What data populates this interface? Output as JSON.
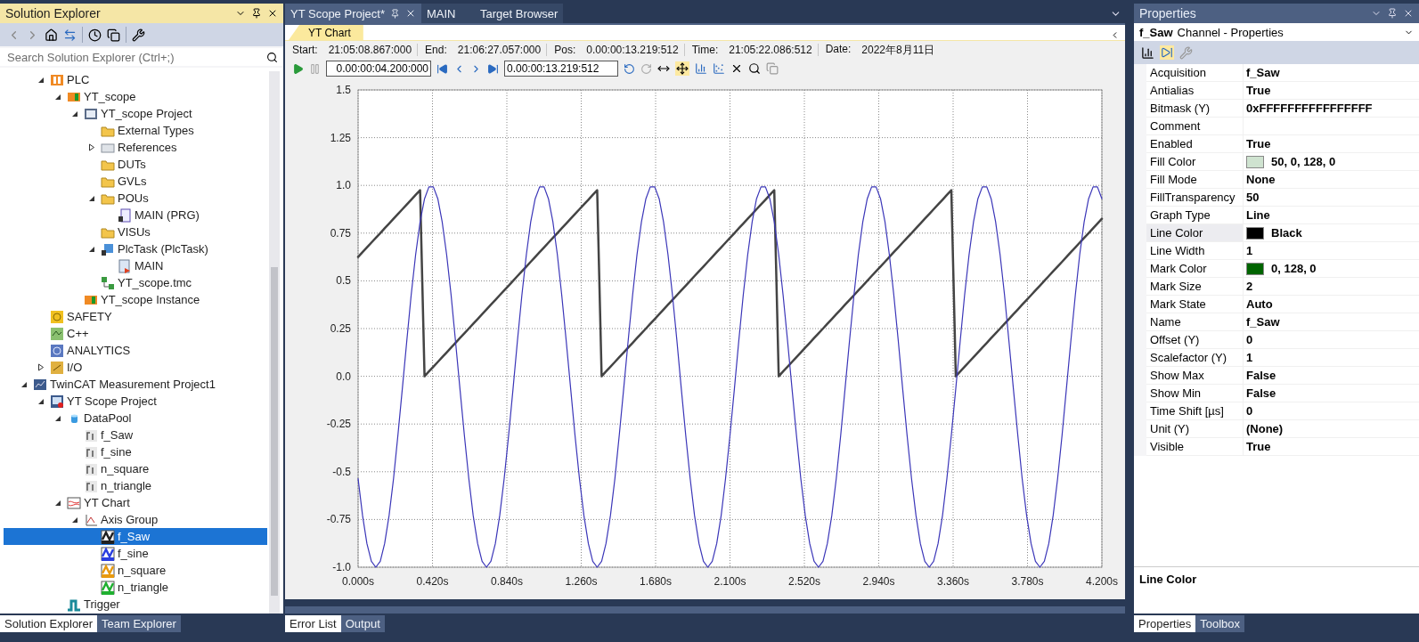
{
  "solution_explorer": {
    "title": "Solution Explorer",
    "search": {
      "placeholder": "Search Solution Explorer (Ctrl+;)"
    },
    "tree": [
      {
        "children": [
          {
            "label": "PLC",
            "kind": "plc",
            "expanded": true,
            "selected": false,
            "children": [
              {
                "label": "YT_scope",
                "kind": "plc-project",
                "expanded": true,
                "selected": false,
                "children": [
                  {
                    "label": "YT_scope Project",
                    "kind": "project",
                    "expanded": true,
                    "selected": false,
                    "children": [
                      {
                        "label": "External Types",
                        "kind": "folder",
                        "selected": false
                      },
                      {
                        "label": "References",
                        "kind": "references",
                        "expanded": false,
                        "selected": false
                      },
                      {
                        "label": "DUTs",
                        "kind": "folder",
                        "selected": false
                      },
                      {
                        "label": "GVLs",
                        "kind": "folder",
                        "selected": false
                      },
                      {
                        "label": "POUs",
                        "kind": "folder",
                        "expanded": true,
                        "selected": false,
                        "children": [
                          {
                            "label": "MAIN (PRG)",
                            "kind": "pou",
                            "selected": false
                          }
                        ]
                      },
                      {
                        "label": "VISUs",
                        "kind": "folder",
                        "selected": false
                      },
                      {
                        "label": "PlcTask (PlcTask)",
                        "kind": "task",
                        "expanded": true,
                        "selected": false,
                        "children": [
                          {
                            "label": "MAIN",
                            "kind": "task-call",
                            "selected": false
                          }
                        ]
                      },
                      {
                        "label": "YT_scope.tmc",
                        "kind": "tmc",
                        "selected": false
                      }
                    ]
                  },
                  {
                    "label": "YT_scope Instance",
                    "kind": "plc-project",
                    "selected": false
                  }
                ]
              }
            ]
          },
          {
            "label": "SAFETY",
            "kind": "safety",
            "selected": false
          },
          {
            "label": "C++",
            "kind": "cpp",
            "selected": false
          },
          {
            "label": "ANALYTICS",
            "kind": "analytics",
            "selected": false
          },
          {
            "label": "I/O",
            "kind": "io",
            "expanded": false,
            "selected": false
          }
        ]
      },
      {
        "label": "TwinCAT Measurement Project1",
        "kind": "measurement",
        "expanded": true,
        "selected": false,
        "children": [
          {
            "label": "YT Scope Project",
            "kind": "scope",
            "expanded": true,
            "selected": false,
            "children": [
              {
                "label": "DataPool",
                "kind": "datapool",
                "expanded": true,
                "selected": false,
                "children": [
                  {
                    "label": "f_Saw",
                    "kind": "var",
                    "selected": false
                  },
                  {
                    "label": "f_sine",
                    "kind": "var",
                    "selected": false
                  },
                  {
                    "label": "n_square",
                    "kind": "var",
                    "selected": false
                  },
                  {
                    "label": "n_triangle",
                    "kind": "var",
                    "selected": false
                  }
                ]
              },
              {
                "label": "YT Chart",
                "kind": "chart",
                "expanded": true,
                "selected": false,
                "children": [
                  {
                    "label": "Axis Group",
                    "kind": "axis",
                    "expanded": true,
                    "selected": false,
                    "children": [
                      {
                        "label": "f_Saw",
                        "kind": "channel",
                        "color": "#202020",
                        "selected": true
                      },
                      {
                        "label": "f_sine",
                        "kind": "channel",
                        "color": "#2a3ee0",
                        "selected": false
                      },
                      {
                        "label": "n_square",
                        "kind": "channel",
                        "color": "#e89a10",
                        "selected": false
                      },
                      {
                        "label": "n_triangle",
                        "kind": "channel",
                        "color": "#20b030",
                        "selected": false
                      }
                    ]
                  }
                ]
              },
              {
                "label": "Trigger",
                "kind": "trigger",
                "selected": false
              }
            ]
          }
        ]
      }
    ],
    "tabs": [
      {
        "label": "Solution Explorer",
        "selected": true
      },
      {
        "label": "Team Explorer",
        "selected": false
      }
    ]
  },
  "document": {
    "tabs": [
      {
        "label": "YT Scope Project*",
        "selected": true
      },
      {
        "label": "MAIN",
        "selected": false
      },
      {
        "label": "Target Browser",
        "selected": false
      }
    ],
    "chart_tab": "YT Chart",
    "info": [
      {
        "label": "Start:",
        "value": "21:05:08.867:000"
      },
      {
        "label": "End:",
        "value": "21:06:27.057:000"
      },
      {
        "label": "Pos:",
        "value": "0.00:00:13.219:512"
      },
      {
        "label": "Time:",
        "value": "21:05:22.086:512"
      },
      {
        "label": "Date:",
        "value": "2022年8月11日"
      }
    ],
    "span": "0.00:00:04.200:000",
    "position": "0.00:00:13.219:512",
    "chart_data": {
      "type": "line",
      "x": [
        0,
        0.025,
        0.05,
        0.075,
        0.1,
        0.125,
        0.15,
        0.175,
        0.2,
        0.225,
        0.25,
        0.275,
        0.3,
        0.325,
        0.35,
        0.375,
        0.4,
        0.425,
        0.45,
        0.475,
        0.5,
        0.525,
        0.55,
        0.575,
        0.6,
        0.625,
        0.65,
        0.675,
        0.7,
        0.725,
        0.75,
        0.775,
        0.8,
        0.825,
        0.85,
        0.875,
        0.9,
        0.925,
        0.95,
        0.975,
        1,
        1.025,
        1.05,
        1.075,
        1.1,
        1.125,
        1.15,
        1.175,
        1.2,
        1.225,
        1.25,
        1.275,
        1.3,
        1.325,
        1.35,
        1.375,
        1.4,
        1.425,
        1.45,
        1.475,
        1.5,
        1.525,
        1.55,
        1.575,
        1.6,
        1.625,
        1.65,
        1.675,
        1.7,
        1.725,
        1.75,
        1.775,
        1.8,
        1.825,
        1.85,
        1.875,
        1.9,
        1.925,
        1.95,
        1.975,
        2,
        2.025,
        2.05,
        2.075,
        2.1,
        2.125,
        2.15,
        2.175,
        2.2,
        2.225,
        2.25,
        2.275,
        2.3,
        2.325,
        2.35,
        2.375,
        2.4,
        2.425,
        2.45,
        2.475,
        2.5,
        2.525,
        2.55,
        2.575,
        2.6,
        2.625,
        2.65,
        2.675,
        2.7,
        2.725,
        2.75,
        2.775,
        2.8,
        2.825,
        2.85,
        2.875,
        2.9,
        2.925,
        2.95,
        2.975,
        3,
        3.025,
        3.05,
        3.075,
        3.1,
        3.125,
        3.15,
        3.175,
        3.2,
        3.225,
        3.25,
        3.275,
        3.3,
        3.325,
        3.35,
        3.375,
        3.4,
        3.425,
        3.45,
        3.475,
        3.5,
        3.525,
        3.55,
        3.575,
        3.6,
        3.625,
        3.65,
        3.675,
        3.7,
        3.725,
        3.75,
        3.775,
        3.8,
        3.825,
        3.85,
        3.875,
        3.9,
        3.925,
        3.95,
        3.975,
        4,
        4.025,
        4.05,
        4.075,
        4.1,
        4.125,
        4.15,
        4.175,
        4.2
      ],
      "series": [
        {
          "color": "#444444",
          "values": [
            0.625,
            0.65,
            0.675,
            0.7,
            0.725,
            0.75,
            0.775,
            0.8,
            0.825,
            0.85,
            0.875,
            0.9,
            0.925,
            0.95,
            0.975,
            0,
            0.025,
            0.05,
            0.075,
            0.1,
            0.125,
            0.15,
            0.175,
            0.2,
            0.225,
            0.25,
            0.275,
            0.3,
            0.325,
            0.35,
            0.375,
            0.4,
            0.425,
            0.45,
            0.475,
            0.5,
            0.525,
            0.55,
            0.575,
            0.6,
            0.625,
            0.65,
            0.675,
            0.7,
            0.725,
            0.75,
            0.775,
            0.8,
            0.825,
            0.85,
            0.875,
            0.9,
            0.925,
            0.95,
            0.975,
            0,
            0.025,
            0.05,
            0.075,
            0.1,
            0.125,
            0.15,
            0.175,
            0.2,
            0.225,
            0.25,
            0.275,
            0.3,
            0.325,
            0.35,
            0.375,
            0.4,
            0.425,
            0.45,
            0.475,
            0.5,
            0.525,
            0.55,
            0.575,
            0.6,
            0.625,
            0.65,
            0.675,
            0.7,
            0.725,
            0.75,
            0.775,
            0.8,
            0.825,
            0.85,
            0.875,
            0.9,
            0.925,
            0.95,
            0.975,
            0,
            0.025,
            0.05,
            0.075,
            0.1,
            0.125,
            0.15,
            0.175,
            0.2,
            0.225,
            0.25,
            0.275,
            0.3,
            0.325,
            0.35,
            0.375,
            0.4,
            0.425,
            0.45,
            0.475,
            0.5,
            0.525,
            0.55,
            0.575,
            0.6,
            0.625,
            0.65,
            0.675,
            0.7,
            0.725,
            0.75,
            0.775,
            0.8,
            0.825,
            0.85,
            0.875,
            0.9,
            0.925,
            0.95,
            0.975,
            0,
            0.025,
            0.05,
            0.075,
            0.1,
            0.125,
            0.15,
            0.175,
            0.2,
            0.225,
            0.25,
            0.275,
            0.3,
            0.325,
            0.35,
            0.375,
            0.4,
            0.425,
            0.45,
            0.475,
            0.5,
            0.525,
            0.55,
            0.575,
            0.6,
            0.625,
            0.65,
            0.675,
            0.7,
            0.725,
            0.75,
            0.775,
            0.8,
            0.825
          ]
        },
        {
          "color": "#3b36b8",
          "values": [
            -0.536,
            -0.729,
            -0.876,
            -0.969,
            -1,
            -0.969,
            -0.876,
            -0.729,
            -0.536,
            -0.309,
            -0.063,
            0.187,
            0.426,
            0.637,
            0.809,
            0.93,
            0.992,
            0.992,
            0.93,
            0.809,
            0.637,
            0.426,
            0.187,
            -0.063,
            -0.309,
            -0.536,
            -0.729,
            -0.876,
            -0.969,
            -1,
            -0.969,
            -0.876,
            -0.729,
            -0.536,
            -0.309,
            -0.063,
            0.187,
            0.426,
            0.637,
            0.809,
            0.93,
            0.992,
            0.992,
            0.93,
            0.809,
            0.637,
            0.426,
            0.187,
            -0.063,
            -0.309,
            -0.536,
            -0.729,
            -0.876,
            -0.969,
            -1,
            -0.969,
            -0.876,
            -0.729,
            -0.536,
            -0.309,
            -0.063,
            0.187,
            0.426,
            0.637,
            0.809,
            0.93,
            0.992,
            0.992,
            0.93,
            0.809,
            0.637,
            0.426,
            0.187,
            -0.063,
            -0.309,
            -0.536,
            -0.729,
            -0.876,
            -0.969,
            -1,
            -0.969,
            -0.876,
            -0.729,
            -0.536,
            -0.309,
            -0.063,
            0.187,
            0.426,
            0.637,
            0.809,
            0.93,
            0.992,
            0.992,
            0.93,
            0.809,
            0.637,
            0.426,
            0.187,
            -0.063,
            -0.309,
            -0.536,
            -0.729,
            -0.876,
            -0.969,
            -1,
            -0.969,
            -0.876,
            -0.729,
            -0.536,
            -0.309,
            -0.063,
            0.187,
            0.426,
            0.637,
            0.809,
            0.93,
            0.992,
            0.992,
            0.93,
            0.809,
            0.637,
            0.426,
            0.187,
            -0.063,
            -0.309,
            -0.536,
            -0.729,
            -0.876,
            -0.969,
            -1,
            -0.969,
            -0.876,
            -0.729,
            -0.536,
            -0.309,
            -0.063,
            0.187,
            0.426,
            0.637,
            0.809,
            0.93,
            0.992,
            0.992,
            0.93,
            0.809,
            0.637,
            0.426,
            0.187,
            -0.063,
            -0.309,
            -0.536,
            -0.729,
            -0.876,
            -0.969,
            -1,
            -0.969,
            -0.876,
            -0.729,
            -0.536,
            -0.309,
            -0.063,
            0.187,
            0.426,
            0.637,
            0.809,
            0.93,
            0.992,
            0.992,
            0.93
          ]
        }
      ],
      "xlim": [
        0,
        4.2
      ],
      "ylim": [
        -1,
        1.5
      ],
      "grid": true,
      "xticks": [
        {
          "value": 0,
          "label": "0.000s"
        },
        {
          "value": 0.42,
          "label": "0.420s"
        },
        {
          "value": 0.84,
          "label": "0.840s"
        },
        {
          "value": 1.26,
          "label": "1.260s"
        },
        {
          "value": 1.68,
          "label": "1.680s"
        },
        {
          "value": 2.1,
          "label": "2.100s"
        },
        {
          "value": 2.52,
          "label": "2.520s"
        },
        {
          "value": 2.94,
          "label": "2.940s"
        },
        {
          "value": 3.36,
          "label": "3.360s"
        },
        {
          "value": 3.78,
          "label": "3.780s"
        },
        {
          "value": 4.2,
          "label": "4.200s"
        }
      ],
      "yticks": [
        {
          "value": 1.5,
          "label": "1.5"
        },
        {
          "value": 1.25,
          "label": "1.25"
        },
        {
          "value": 1,
          "label": "1.0"
        },
        {
          "value": 0.75,
          "label": "0.75"
        },
        {
          "value": 0.5,
          "label": "0.5"
        },
        {
          "value": 0.25,
          "label": "0.25"
        },
        {
          "value": 0,
          "label": "0.0"
        },
        {
          "value": -0.25,
          "label": "-0.25"
        },
        {
          "value": -0.5,
          "label": "-0.5"
        },
        {
          "value": -0.75,
          "label": "-0.75"
        },
        {
          "value": -1,
          "label": "-1.0"
        }
      ]
    }
  },
  "bottom_tabs": [
    {
      "label": "Error List",
      "selected": true
    },
    {
      "label": "Output",
      "selected": false
    }
  ],
  "properties": {
    "title": "Properties",
    "object": "f_Saw",
    "object_type": "Channel - Properties",
    "rows": [
      {
        "name": "Acquisition",
        "value": "f_Saw",
        "selected": false
      },
      {
        "name": "Antialias",
        "value": "True",
        "selected": false
      },
      {
        "name": "Bitmask (Y)",
        "value": "0xFFFFFFFFFFFFFFFF",
        "selected": false
      },
      {
        "name": "Comment",
        "selected": false
      },
      {
        "name": "Enabled",
        "value": "True",
        "selected": false
      },
      {
        "name": "Fill Color",
        "value": "50, 0, 128, 0",
        "color": "#cfe3d0",
        "selected": false
      },
      {
        "name": "Fill Mode",
        "value": "None",
        "selected": false
      },
      {
        "name": "FillTransparency",
        "value": "50",
        "selected": false
      },
      {
        "name": "Graph Type",
        "value": "Line",
        "selected": false
      },
      {
        "name": "Line Color",
        "value": "Black",
        "color": "#000000",
        "selected": true
      },
      {
        "name": "Line Width",
        "value": "1",
        "selected": false
      },
      {
        "name": "Mark Color",
        "value": "0, 128, 0",
        "color": "#006400",
        "selected": false
      },
      {
        "name": "Mark Size",
        "value": "2",
        "selected": false
      },
      {
        "name": "Mark State",
        "value": "Auto",
        "selected": false
      },
      {
        "name": "Name",
        "value": "f_Saw",
        "selected": false
      },
      {
        "name": "Offset (Y)",
        "value": "0",
        "selected": false
      },
      {
        "name": "Scalefactor (Y)",
        "value": "1",
        "selected": false
      },
      {
        "name": "Show Max",
        "value": "False",
        "selected": false
      },
      {
        "name": "Show Min",
        "value": "False",
        "selected": false
      },
      {
        "name": "Time Shift [µs]",
        "value": "0",
        "selected": false
      },
      {
        "name": "Unit (Y)",
        "value": "(None)",
        "selected": false
      },
      {
        "name": "Visible",
        "value": "True",
        "selected": false
      }
    ],
    "description": "Line Color",
    "tabs": [
      {
        "label": "Properties",
        "selected": true
      },
      {
        "label": "Toolbox",
        "selected": false
      }
    ]
  }
}
